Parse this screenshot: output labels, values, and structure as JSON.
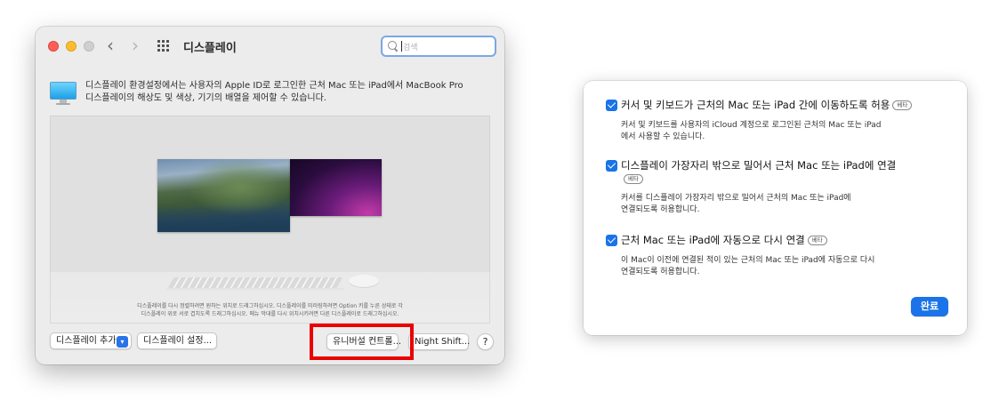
{
  "window": {
    "title": "디스플레이",
    "nav_back": "‹",
    "nav_forward": "›",
    "search": {
      "placeholder": "검색",
      "value": ""
    },
    "info_line1": "디스플레이 환경설정에서는 사용자의 Apple ID로 로그인한 근처 Mac 또는 iPad에서 MacBook Pro",
    "info_line2": "디스플레이의 해상도 및 색상, 기기의 배열을 제어할 수 있습니다.",
    "help_line1": "디스플레이를 다시 정렬하려면 원하는 위치로 드래그하십시오. 디스플레이를 미러링하려면 Option 키를 누른 상태로 각",
    "help_line2": "디스플레이 위로 서로 겹치도록 드래그하십시오. 메뉴 막대를 다시 위치시키려면 다른 디스플레이로 드래그하십시오.",
    "buttons": {
      "add_display": "디스플레이 추가",
      "display_settings": "디스플레이 설정...",
      "universal_control": "유니버설 컨트롤...",
      "night_shift": "Night Shift...",
      "help": "?"
    }
  },
  "sheet": {
    "options": [
      {
        "title": "커서 및 키보드가 근처의 Mac 또는 iPad 간에 이동하도록 허용",
        "badge": "베타",
        "checked": true,
        "desc_line1": "커서 및 키보드를 사용자의 iCloud 계정으로 로그인된 근처의 Mac 또는 iPad",
        "desc_line2": "에서 사용할 수 있습니다."
      },
      {
        "title": "디스플레이 가장자리 밖으로 밀어서 근처 Mac 또는 iPad에 연결",
        "badge": "베타",
        "checked": true,
        "desc_line1": "커서를 디스플레이 가장자리 밖으로 밀어서 근처의 Mac 또는 iPad에",
        "desc_line2": "연결되도록 허용합니다."
      },
      {
        "title": "근처 Mac 또는 iPad에 자동으로 다시 연결",
        "badge": "베타",
        "checked": true,
        "desc_line1": "이 Mac이 이전에 연결된 적이 있는 근처의 Mac 또는 iPad에 자동으로 다시",
        "desc_line2": "연결되도록 허용합니다."
      }
    ],
    "done_button": "완료"
  },
  "colors": {
    "accent": "#1a73e8",
    "highlight_box": "#ea0000",
    "traffic_red": "#ff5f57",
    "traffic_yellow": "#febc2e"
  },
  "icons": [
    "monitor-icon",
    "search-icon",
    "grid-icon",
    "chevron-down-icon",
    "checkbox-icon"
  ]
}
